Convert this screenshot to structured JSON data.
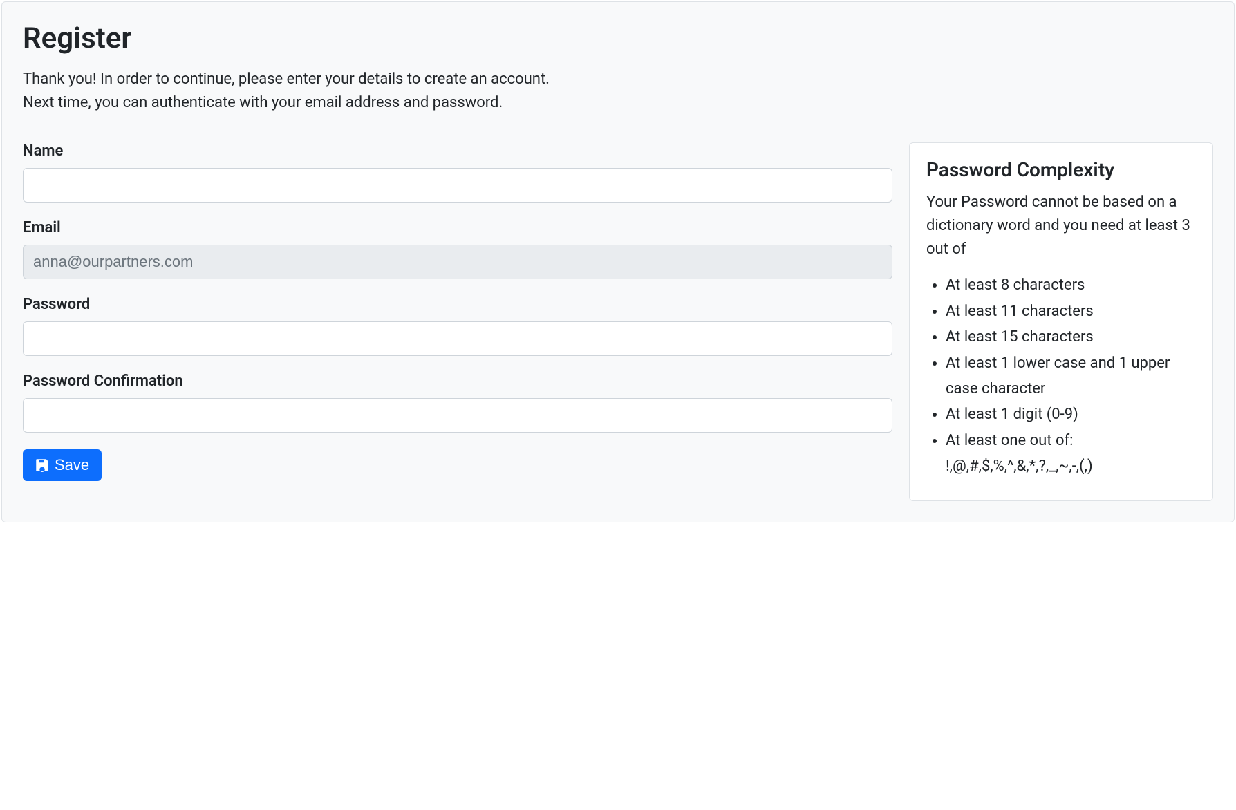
{
  "page": {
    "title": "Register",
    "intro_line1": "Thank you! In order to continue, please enter your details to create an account.",
    "intro_line2": "Next time, you can authenticate with your email address and password."
  },
  "form": {
    "name": {
      "label": "Name",
      "value": ""
    },
    "email": {
      "label": "Email",
      "value": "anna@ourpartners.com"
    },
    "password": {
      "label": "Password",
      "value": ""
    },
    "password_confirmation": {
      "label": "Password Confirmation",
      "value": ""
    },
    "save_label": "Save"
  },
  "complexity": {
    "title": "Password Complexity",
    "description": "Your Password cannot be based on a dictionary word and you need at least 3 out of",
    "rules": [
      "At least 8 characters",
      "At least 11 characters",
      "At least 15 characters",
      "At least 1 lower case and 1 upper case character",
      "At least 1 digit (0-9)",
      "At least one out of: !,@,#,$,%,^,&,*,?,_,~,-,(,)"
    ]
  }
}
